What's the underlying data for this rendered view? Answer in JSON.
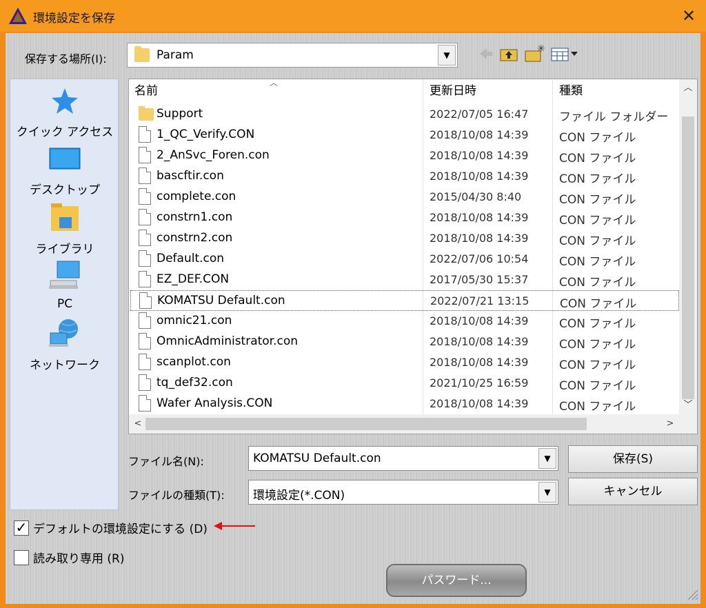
{
  "window": {
    "title": "環境設定を保存",
    "close_glyph": "✕"
  },
  "location": {
    "label": "保存する場所(I):",
    "value": "Param"
  },
  "places": [
    {
      "label": "クイック アクセス",
      "icon": "star-icon"
    },
    {
      "label": "デスクトップ",
      "icon": "desktop-icon"
    },
    {
      "label": "ライブラリ",
      "icon": "library-icon"
    },
    {
      "label": "PC",
      "icon": "pc-icon"
    },
    {
      "label": "ネットワーク",
      "icon": "network-icon"
    }
  ],
  "columns": {
    "name": "名前",
    "date": "更新日時",
    "type": "種類"
  },
  "files": [
    {
      "name": "Support",
      "date": "2022/07/05 16:47",
      "type": "ファイル フォルダー",
      "folder": true
    },
    {
      "name": "1_QC_Verify.CON",
      "date": "2018/10/08 14:39",
      "type": "CON ファイル"
    },
    {
      "name": "2_AnSvc_Foren.con",
      "date": "2018/10/08 14:39",
      "type": "CON ファイル"
    },
    {
      "name": "bascftir.con",
      "date": "2018/10/08 14:39",
      "type": "CON ファイル"
    },
    {
      "name": "complete.con",
      "date": "2015/04/30 8:40",
      "type": "CON ファイル"
    },
    {
      "name": "constrn1.con",
      "date": "2018/10/08 14:39",
      "type": "CON ファイル"
    },
    {
      "name": "constrn2.con",
      "date": "2018/10/08 14:39",
      "type": "CON ファイル"
    },
    {
      "name": "Default.con",
      "date": "2022/07/06 10:54",
      "type": "CON ファイル"
    },
    {
      "name": "EZ_DEF.CON",
      "date": "2017/05/30 15:37",
      "type": "CON ファイル"
    },
    {
      "name": "KOMATSU Default.con",
      "date": "2022/07/21 13:15",
      "type": "CON ファイル",
      "selected": true
    },
    {
      "name": "omnic21.con",
      "date": "2018/10/08 14:39",
      "type": "CON ファイル"
    },
    {
      "name": "OmnicAdministrator.con",
      "date": "2018/10/08 14:39",
      "type": "CON ファイル"
    },
    {
      "name": "scanplot.con",
      "date": "2018/10/08 14:39",
      "type": "CON ファイル"
    },
    {
      "name": "tq_def32.con",
      "date": "2021/10/25 16:59",
      "type": "CON ファイル"
    },
    {
      "name": "Wafer Analysis.CON",
      "date": "2018/10/08 14:39",
      "type": "CON ファイル"
    }
  ],
  "filename": {
    "label": "ファイル名(N):",
    "value": "KOMATSU Default.con"
  },
  "filetype": {
    "label": "ファイルの種類(T):",
    "value": "環境設定(*.CON)"
  },
  "buttons": {
    "save": "保存(S)",
    "cancel": "キャンセル",
    "password": "パスワード..."
  },
  "options": {
    "default_label": "デフォルトの環境設定にする (D)",
    "default_checked": true,
    "readonly_label": "読み取り専用 (R)",
    "readonly_checked": false
  },
  "colors": {
    "titlebar": "#f59a1e",
    "annotation_arrow": "#e01010"
  }
}
